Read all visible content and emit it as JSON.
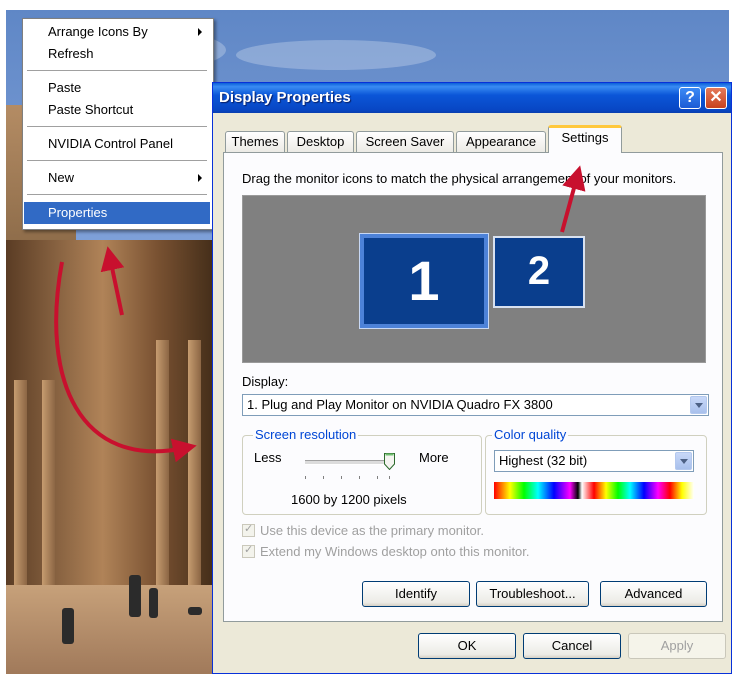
{
  "context_menu": {
    "items": [
      {
        "label": "Arrange Icons By"
      },
      {
        "label": "Refresh"
      },
      {
        "label": "Paste"
      },
      {
        "label": "Paste Shortcut"
      },
      {
        "label": "NVIDIA Control Panel"
      },
      {
        "label": "New"
      },
      {
        "label": "Properties"
      }
    ]
  },
  "dialog": {
    "title": "Display Properties",
    "help_symbol": "?",
    "close_symbol": "✕",
    "tabs": [
      {
        "label": "Themes"
      },
      {
        "label": "Desktop"
      },
      {
        "label": "Screen Saver"
      },
      {
        "label": "Appearance"
      },
      {
        "label": "Settings"
      }
    ],
    "instruction": "Drag the monitor icons to match the physical arrangement of your monitors.",
    "monitors": [
      {
        "label": "1"
      },
      {
        "label": "2"
      }
    ],
    "display_label": "Display:",
    "display_value": "1. Plug and Play Monitor on NVIDIA Quadro FX 3800",
    "resolution": {
      "title": "Screen resolution",
      "less": "Less",
      "more": "More",
      "value": "1600 by 1200 pixels",
      "level": 0.9
    },
    "color_quality": {
      "title": "Color quality",
      "value": "Highest (32 bit)"
    },
    "checkboxes": [
      {
        "label": "Use this device as the primary monitor.",
        "checked": true
      },
      {
        "label": "Extend my Windows desktop onto this monitor.",
        "checked": true
      }
    ],
    "buttons": {
      "identify": "Identify",
      "troubleshoot": "Troubleshoot...",
      "advanced": "Advanced",
      "ok": "OK",
      "cancel": "Cancel",
      "apply": "Apply"
    }
  },
  "colors": {
    "title_blue": "#0b56d8",
    "selection": "#316ac5",
    "annotation_red": "#c8102e"
  }
}
